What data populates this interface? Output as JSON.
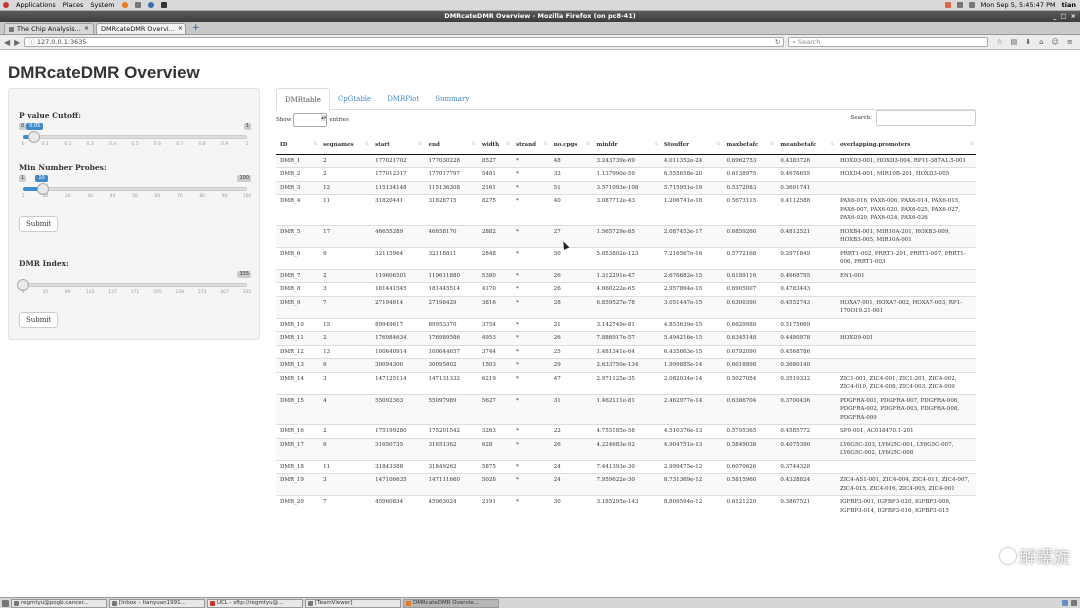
{
  "desktop": {
    "menu": [
      "Applications",
      "Places",
      "System"
    ],
    "clock": "Mon Sep  5,  5:45:47 PM",
    "user": "tian"
  },
  "window": {
    "title": "DMRcateDMR Overview - Mozilla Firefox (on pc8-41)"
  },
  "browser": {
    "tabs": [
      {
        "label": "The Chip Analysis...",
        "active": false
      },
      {
        "label": "DMRcateDMR Overvi...",
        "active": true
      }
    ],
    "new_tab": "+",
    "url": "127.0.0.1:3635",
    "search_placeholder": "Search"
  },
  "page": {
    "title": "DMRcateDMR Overview",
    "pvalue": {
      "label": "P value Cutoff:",
      "min": "0",
      "max": "1",
      "value": "0.05",
      "value_num": 0.05,
      "range": [
        0,
        1
      ],
      "ticks": [
        "0",
        "0.1",
        "0.2",
        "0.3",
        "0.4",
        "0.5",
        "0.6",
        "0.7",
        "0.8",
        "0.9",
        "1"
      ]
    },
    "minprobes": {
      "label": "Min Number Probes:",
      "min": "1",
      "max": "100",
      "value": "10",
      "value_num": 10,
      "range": [
        1,
        100
      ],
      "ticks": [
        "1",
        "10",
        "20",
        "30",
        "40",
        "50",
        "60",
        "70",
        "80",
        "90",
        "100"
      ]
    },
    "submit1": "Submit",
    "dmrindex": {
      "label": "DMR Index:",
      "max": "335",
      "value_num": 1,
      "range": [
        1,
        335
      ],
      "ticks": [
        "1",
        "35",
        "69",
        "103",
        "137",
        "171",
        "205",
        "239",
        "273",
        "307",
        "335"
      ]
    },
    "submit2": "Submit",
    "tabs": [
      "DMRtable",
      "CpGtable",
      "DMRPlot",
      "Summary"
    ],
    "active_tab": "DMRtable",
    "show_label": "Show",
    "entries_label": "entries",
    "search_label": "Search:",
    "columns": [
      "ID",
      "seqnames",
      "start",
      "end",
      "width",
      "strand",
      "no.cpgs",
      "minfdr",
      "Stouffer",
      "maxbetafc",
      "meanbetafc",
      "overlapping.promoters"
    ],
    "rows": [
      [
        "DMR_1",
        "2",
        "177021702",
        "177030228",
        "8527",
        "*",
        "48",
        "3.243739e-69",
        "4.011352e-24",
        "0.6962753",
        "0.4383726",
        "HOXD3-001, HOXD3-004, RP11-387A1.5-001"
      ],
      [
        "DMR_2",
        "2",
        "177012317",
        "177017797",
        "5481",
        "*",
        "33",
        "1.137990e-59",
        "6.555658e-20",
        "0.6138975",
        "0.4676655",
        "HOXD4-001, MIR10B-201, HOXD3-005"
      ],
      [
        "DMR_3",
        "12",
        "115134148",
        "115136308",
        "2161",
        "*",
        "51",
        "3.571093e-108",
        "5.715951e-19",
        "0.5372083",
        "0.3601741",
        ""
      ],
      [
        "DMR_4",
        "11",
        "31820441",
        "31828715",
        "8275",
        "*",
        "40",
        "3.087712e-43",
        "1.206741e-18",
        "0.5673115",
        "0.4112588",
        "PAX6-016, PAX6-006, PAX6-014, PAX6-015, PAX6-007, PAX6-020, PAX6-025, PAX6-027, PAX6-029, PAX6-024, PAX6-026"
      ],
      [
        "DMR_5",
        "17",
        "46655289",
        "46658170",
        "2882",
        "*",
        "27",
        "1.565729e-85",
        "2.087453e-17",
        "0.6859260",
        "0.4812521",
        "HOXB4-001, MIR10A-201, HOXB3-009, HOXB3-005, MIR10A-001"
      ],
      [
        "DMR_6",
        "6",
        "32115964",
        "32118811",
        "2848",
        "*",
        "50",
        "5.053802e-123",
        "7.216567e-16",
        "0.5772168",
        "0.2971849",
        "PRRT1-002, PRRT1-201, PRRT1-007, PRRT1-006, PRRT1-003"
      ],
      [
        "DMR_7",
        "2",
        "119606501",
        "119611880",
        "5380",
        "*",
        "26",
        "1.312291e-47",
        "2.676682e-15",
        "0.6189116",
        "0.4668795",
        "EN1-001"
      ],
      [
        "DMR_8",
        "3",
        "181441545",
        "181445514",
        "4170",
        "*",
        "26",
        "4.660222e-65",
        "2.957864e-15",
        "0.6905007",
        "0.4783443",
        ""
      ],
      [
        "DMR_9",
        "7",
        "27194614",
        "27198429",
        "3816",
        "*",
        "28",
        "6.859527e-78",
        "3.051447e-15",
        "0.6300390",
        "0.4552743",
        "HOXA7-001, HOXA7-002, HOXA7-003, RP1-170O19.21-001"
      ],
      [
        "DMR_10",
        "15",
        "89949617",
        "89953370",
        "3754",
        "*",
        "21",
        "3.142749e-81",
        "4.853639e-15",
        "0.6629988",
        "0.5175669",
        ""
      ],
      [
        "DMR_11",
        "2",
        "176984634",
        "176989586",
        "4953",
        "*",
        "26",
        "7.886917e-57",
        "5.494216e-15",
        "0.6345148",
        "0.4480978",
        "HOXD9-001"
      ],
      [
        "DMR_12",
        "13",
        "100640914",
        "100644657",
        "3744",
        "*",
        "25",
        "1.481341e-64",
        "6.435663e-15",
        "0.6792090",
        "0.4568786",
        ""
      ],
      [
        "DMR_13",
        "6",
        "30094300",
        "30095802",
        "1503",
        "*",
        "29",
        "2.633750e-134",
        "1.999885e-14",
        "0.6018898",
        "0.3680140",
        ""
      ],
      [
        "DMR_14",
        "3",
        "147125114",
        "147131332",
        "6219",
        "*",
        "47",
        "2.971125e-35",
        "2.082034e-14",
        "0.5027054",
        "0.3519332",
        "ZIC1-001, ZIC4-001, ZIC1-201, ZIC4-002, ZIC4-010, ZIC4-008, ZIC4-003, ZIC4-009"
      ],
      [
        "DMR_15",
        "4",
        "55092363",
        "55097989",
        "5627",
        "*",
        "31",
        "1.462111e-81",
        "2.462977e-14",
        "0.6366704",
        "0.3700436",
        "PDGFRA-001, PDGFRA-007, PDGFRA-006, PDGFRA-002, PDGFRA-003, PDGFRA-008, PDGFRA-009"
      ],
      [
        "DMR_16",
        "2",
        "175199280",
        "175201542",
        "3263",
        "*",
        "22",
        "4.755185e-58",
        "4.510376e-13",
        "0.5795365",
        "0.4585772",
        "SP9-001, AC018470.1-201"
      ],
      [
        "DMR_17",
        "6",
        "31650735",
        "31651362",
        "628",
        "*",
        "26",
        "4.224683e-92",
        "4.904751e-13",
        "0.5849038",
        "0.4075390",
        "LY6G5C-203, LY6G5C-001, LY6G5C-007, LY6G5C-002, LY6G5C-008"
      ],
      [
        "DMR_18",
        "11",
        "31843388",
        "31849262",
        "5875",
        "*",
        "24",
        "7.441393e-30",
        "2.999475e-12",
        "0.6070626",
        "0.3744328",
        ""
      ],
      [
        "DMR_19",
        "3",
        "147106635",
        "147111660",
        "5026",
        "*",
        "24",
        "7.959622e-30",
        "8.731369e-12",
        "0.5815960",
        "0.4328824",
        "ZIC4-AS1-001, ZIC4-004, ZIC4-011, ZIC4-007, ZIC4-015, ZIC4-016, ZIC4-005, ZIC4-001"
      ],
      [
        "DMR_20",
        "7",
        "45960834",
        "45963024",
        "2191",
        "*",
        "30",
        "3.185295e-143",
        "8.809594e-12",
        "0.6121220",
        "0.3867521",
        "IGFBP3-001, IGFBP3-020, IGFBP3-008, IGFBP3-014, IGFBP3-016, IGFBP3-015"
      ]
    ]
  },
  "taskbar": [
    {
      "label": "regmtyu@pogb.cancer...",
      "active": false
    },
    {
      "label": "[Inbox – tianyuan1991...",
      "active": false
    },
    {
      "label": "UCL - sftp://regmtyu@...",
      "active": false
    },
    {
      "label": "[TeamViewer]",
      "active": false
    },
    {
      "label": "DMRcateDMR Overvie...",
      "active": true
    }
  ],
  "watermark": "解螺旋",
  "colors": {
    "link": "#428bca",
    "accent": "#428bca",
    "titlebar": "#4a4a4a"
  }
}
